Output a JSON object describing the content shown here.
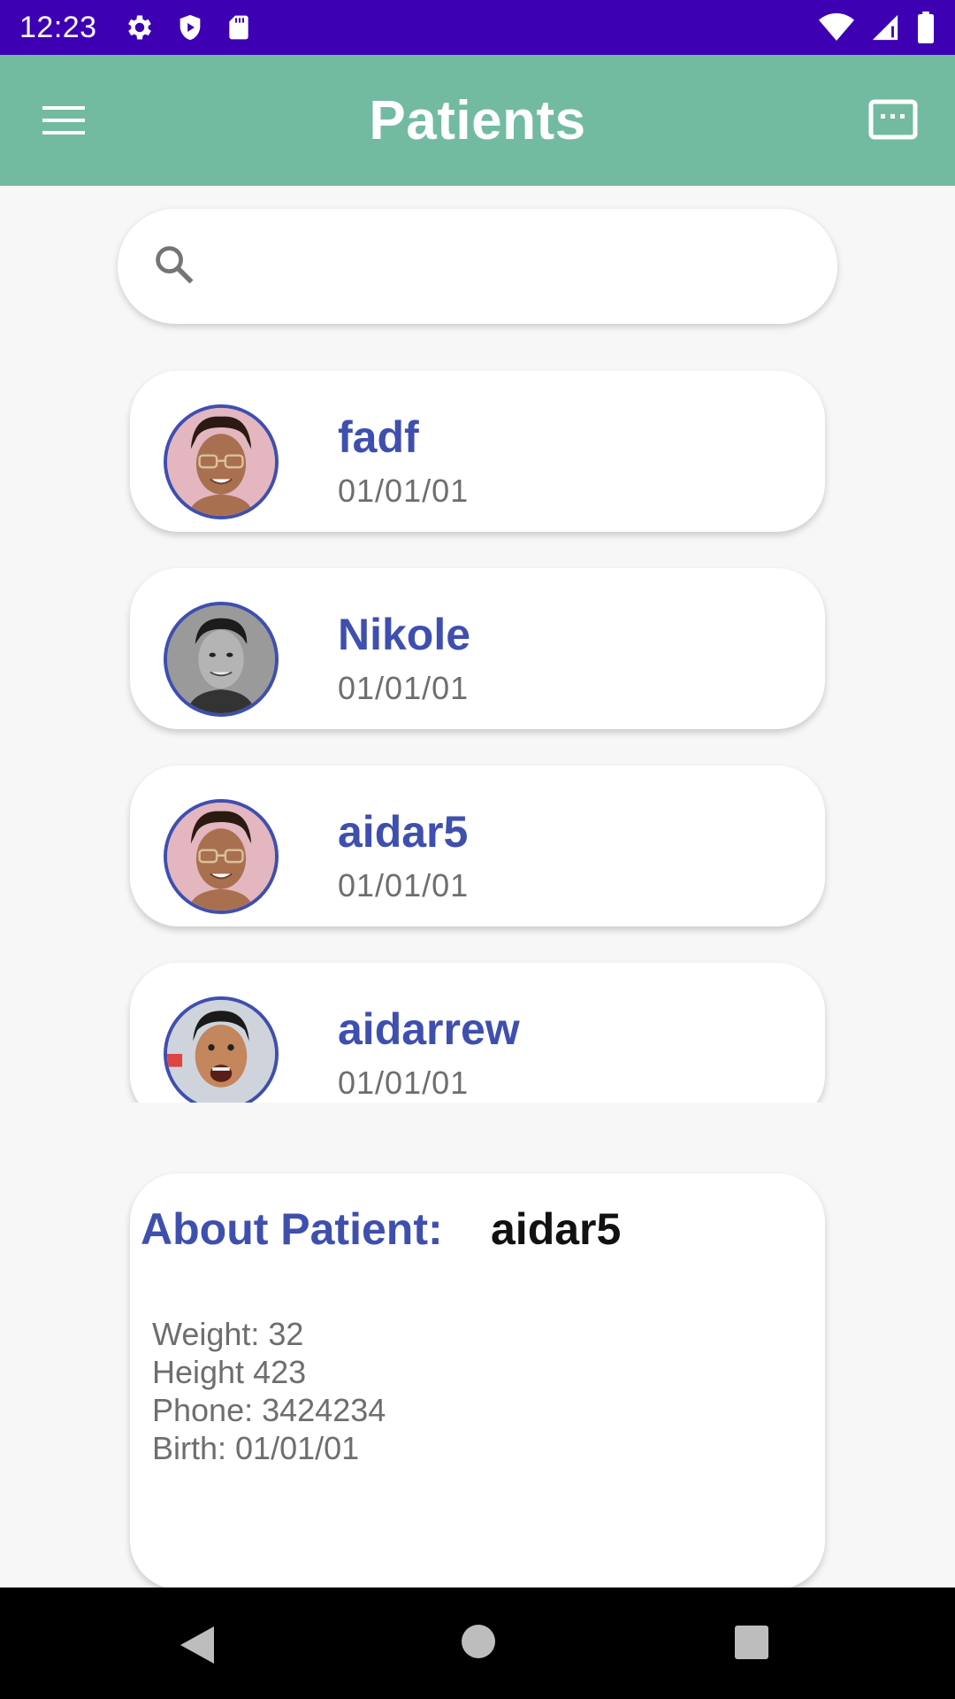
{
  "status_bar": {
    "time": "12:23",
    "left_icons": [
      "gear-icon",
      "shield-icon",
      "sd-card-icon"
    ],
    "right_icons": [
      "wifi-icon",
      "signal-icon",
      "battery-icon"
    ],
    "background": "#3d00b3"
  },
  "app_bar": {
    "title": "Patients",
    "background": "#72bba1",
    "left_icon": "menu-icon",
    "right_icon": "keyboard-icon"
  },
  "search": {
    "icon": "search-icon",
    "value": "",
    "placeholder": ""
  },
  "patients": [
    {
      "name": "fadf",
      "date": "01/01/01",
      "avatar": "avatar-man-dreadlocks-glasses"
    },
    {
      "name": "Nikole",
      "date": "01/01/01",
      "avatar": "avatar-man-grayscale"
    },
    {
      "name": "aidar5",
      "date": "01/01/01",
      "avatar": "avatar-man-dreadlocks-glasses"
    },
    {
      "name": "aidarrew",
      "date": "01/01/01",
      "avatar": "avatar-man-smiling"
    }
  ],
  "about": {
    "label": "About Patient:",
    "name": "aidar5",
    "details": [
      "Weight: 32",
      "Height 423",
      "Phone: 3424234",
      "Birth: 01/01/01"
    ]
  },
  "colors": {
    "accent": "#3f4fae",
    "secondary_text": "#6e6e6e",
    "background": "#f7f7f7"
  },
  "nav_bar": {
    "buttons": [
      "back-icon",
      "home-icon",
      "recents-icon"
    ]
  }
}
